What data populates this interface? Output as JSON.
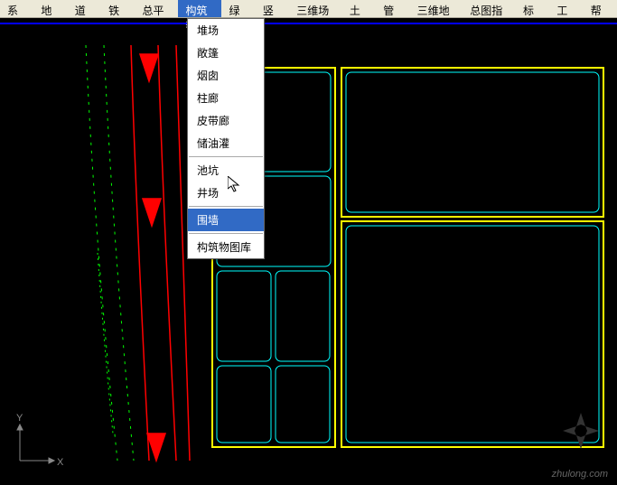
{
  "menubar": {
    "items": [
      "系统",
      "地形",
      "道路",
      "铁路",
      "总平面",
      "构筑物",
      "绿化",
      "竖向",
      "三维场地",
      "土方",
      "管线",
      "三维地物",
      "总图指标",
      "标注",
      "工具",
      "帮助"
    ],
    "active_index": 5
  },
  "dropdown": {
    "groups": [
      [
        "堆场",
        "敞篷",
        "烟囱",
        "柱廊",
        "皮带廊",
        "储油灌"
      ],
      [
        "池坑",
        "井场"
      ],
      [
        "围墙"
      ],
      [
        "构筑物图库"
      ]
    ],
    "highlighted": "围墙"
  },
  "axis": {
    "x": "X",
    "y": "Y"
  },
  "watermark": "zhulong.com"
}
